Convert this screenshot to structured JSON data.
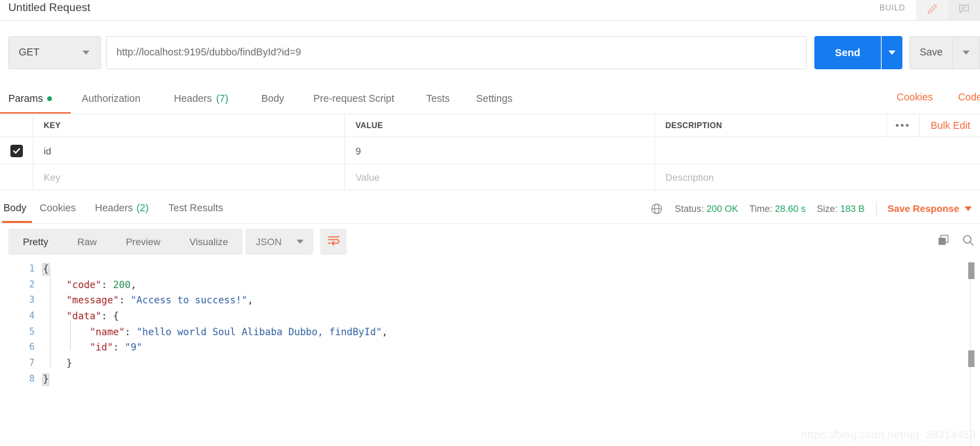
{
  "titlebar": {
    "request_title": "Untitled Request",
    "build_label": "BUILD",
    "pencil_icon": "pencil-icon",
    "comment_icon": "comment-icon"
  },
  "url_row": {
    "method": "GET",
    "url": "http://localhost:9195/dubbo/findById?id=9",
    "send_label": "Send",
    "save_label": "Save"
  },
  "request_tabs": {
    "items": [
      {
        "label": "Params",
        "badge": "",
        "has_dot": true,
        "active": true
      },
      {
        "label": "Authorization",
        "badge": "",
        "has_dot": false,
        "active": false
      },
      {
        "label": "Headers",
        "badge": "(7)",
        "has_dot": false,
        "active": false
      },
      {
        "label": "Body",
        "badge": "",
        "has_dot": false,
        "active": false
      },
      {
        "label": "Pre-request Script",
        "badge": "",
        "has_dot": false,
        "active": false
      },
      {
        "label": "Tests",
        "badge": "",
        "has_dot": false,
        "active": false
      },
      {
        "label": "Settings",
        "badge": "",
        "has_dot": false,
        "active": false
      }
    ],
    "cookies_link": "Cookies",
    "code_link": "Code"
  },
  "params_table": {
    "columns": {
      "key": "KEY",
      "value": "VALUE",
      "description": "DESCRIPTION"
    },
    "bulk_edit": "Bulk Edit",
    "more_menu": "•••",
    "rows": [
      {
        "checked": true,
        "key": "id",
        "value": "9",
        "description": ""
      }
    ],
    "placeholders": {
      "key": "Key",
      "value": "Value",
      "description": "Description"
    }
  },
  "response": {
    "tabs": [
      {
        "label": "Body",
        "badge": "",
        "active": true
      },
      {
        "label": "Cookies",
        "badge": "",
        "active": false
      },
      {
        "label": "Headers",
        "badge": "(2)",
        "active": false
      },
      {
        "label": "Test Results",
        "badge": "",
        "active": false
      }
    ],
    "globe_icon": "globe-icon",
    "status_label": "Status:",
    "status_value": "200 OK",
    "time_label": "Time:",
    "time_value": "28.60 s",
    "size_label": "Size:",
    "size_value": "183 B",
    "save_response": "Save Response"
  },
  "viewer": {
    "modes": [
      {
        "label": "Pretty",
        "active": true
      },
      {
        "label": "Raw",
        "active": false
      },
      {
        "label": "Preview",
        "active": false
      },
      {
        "label": "Visualize",
        "active": false
      }
    ],
    "format": "JSON",
    "wrap_icon": "word-wrap-icon",
    "copy_icon": "copy-icon",
    "search_icon": "search-icon"
  },
  "code": {
    "line_numbers": [
      "1",
      "2",
      "3",
      "4",
      "5",
      "6",
      "7",
      "8"
    ],
    "lines": [
      {
        "n": 1,
        "tokens": [
          {
            "t": "{",
            "c": "brace"
          }
        ]
      },
      {
        "n": 2,
        "tokens": [
          {
            "t": "    ",
            "c": "pun"
          },
          {
            "t": "\"code\"",
            "c": "key"
          },
          {
            "t": ": ",
            "c": "pun"
          },
          {
            "t": "200",
            "c": "num"
          },
          {
            "t": ",",
            "c": "pun"
          }
        ]
      },
      {
        "n": 3,
        "tokens": [
          {
            "t": "    ",
            "c": "pun"
          },
          {
            "t": "\"message\"",
            "c": "key"
          },
          {
            "t": ": ",
            "c": "pun"
          },
          {
            "t": "\"Access to success!\"",
            "c": "str"
          },
          {
            "t": ",",
            "c": "pun"
          }
        ]
      },
      {
        "n": 4,
        "tokens": [
          {
            "t": "    ",
            "c": "pun"
          },
          {
            "t": "\"data\"",
            "c": "key"
          },
          {
            "t": ": {",
            "c": "pun"
          }
        ]
      },
      {
        "n": 5,
        "tokens": [
          {
            "t": "        ",
            "c": "pun"
          },
          {
            "t": "\"name\"",
            "c": "key"
          },
          {
            "t": ": ",
            "c": "pun"
          },
          {
            "t": "\"hello world Soul Alibaba Dubbo, findById\"",
            "c": "str"
          },
          {
            "t": ",",
            "c": "pun"
          }
        ]
      },
      {
        "n": 6,
        "tokens": [
          {
            "t": "        ",
            "c": "pun"
          },
          {
            "t": "\"id\"",
            "c": "key"
          },
          {
            "t": ": ",
            "c": "pun"
          },
          {
            "t": "\"9\"",
            "c": "str"
          }
        ]
      },
      {
        "n": 7,
        "tokens": [
          {
            "t": "    }",
            "c": "pun"
          }
        ]
      },
      {
        "n": 8,
        "tokens": [
          {
            "t": "}",
            "c": "brace"
          }
        ]
      }
    ]
  },
  "watermark": "https://blog.csdn.net/qq_38314459",
  "colors": {
    "accent_orange": "#f26b3a",
    "send_blue": "#177bf0",
    "status_green": "#1aa260",
    "json_key": "#a52222",
    "json_string": "#2e5fa3",
    "json_number": "#1a8a4a",
    "line_number": "#6f9ac0"
  }
}
